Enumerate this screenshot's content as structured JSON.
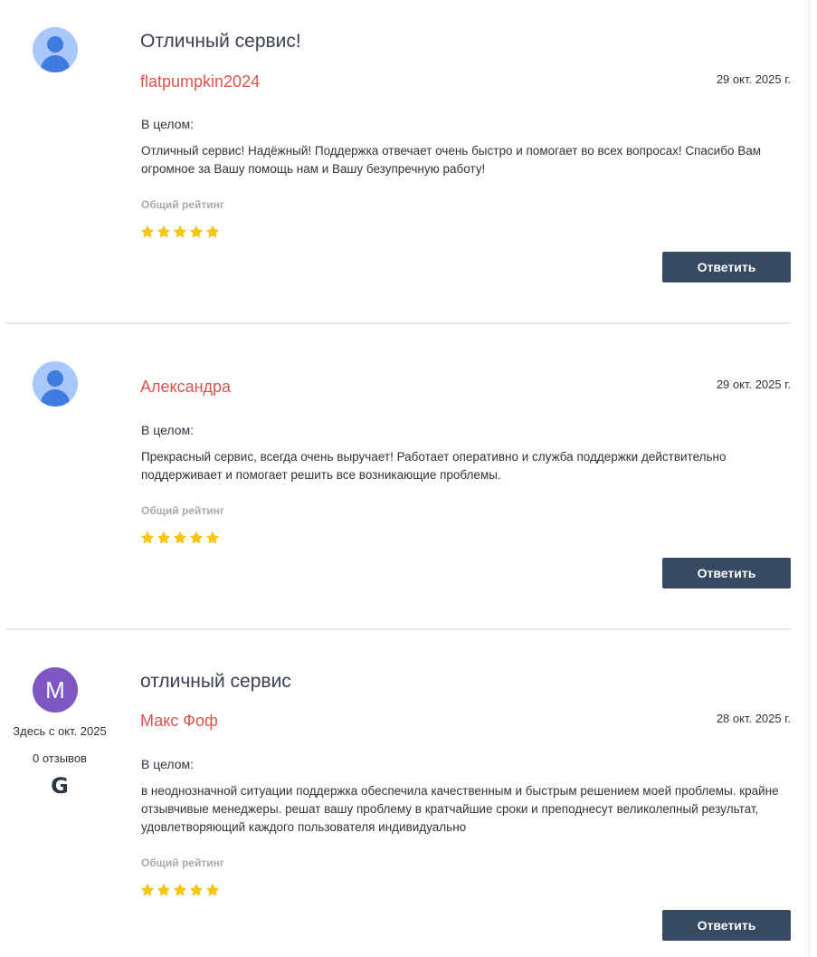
{
  "reviews": [
    {
      "title": "Отличный сервис!",
      "author": "flatpumpkin2024",
      "date": "29 окт. 2025 г.",
      "overall_label": "В целом:",
      "text": "Отличный сервис! Надёжный! Поддержка отвечает очень быстро и помогает во всех вопросах! Спасибо Вам огромное за Вашу помощь нам и Вашу безупречную работу!",
      "rating_label": "Общий рейтинг",
      "rating": 5,
      "reply_label": "Ответить"
    },
    {
      "title": "",
      "author": "Александра",
      "date": "29 окт. 2025 г.",
      "overall_label": "В целом:",
      "text": "Прекрасный сервис, всегда очень выручает! Работает оперативно и служба поддержки действительно поддерживает и помогает решить все возникающие проблемы.",
      "rating_label": "Общий рейтинг",
      "rating": 5,
      "reply_label": "Ответить"
    },
    {
      "title": "отличный сервис",
      "author": "Макс Фоф",
      "avatar_letter": "M",
      "member_since": "Здесь с окт. 2025",
      "review_count": "0 отзывов",
      "source_icon": "google-g-icon",
      "source_glyph": "G",
      "date": "28 окт. 2025 г.",
      "overall_label": "В целом:",
      "text": "в неоднозначной ситуации поддержка обеспечила качественным и быстрым решением моей проблемы. крайне отзывчивые менеджеры. решат вашу проблему в кратчайшие сроки и преподнесут великолепный результат, удовлетворяющий каждого пользователя индивидуально",
      "rating_label": "Общий рейтинг",
      "rating": 5,
      "reply_label": "Ответить"
    }
  ],
  "colors": {
    "author": "#d9534f",
    "star": "#f5c518",
    "reply_button": "#364a63",
    "avatar_default": "#a8c7fa",
    "avatar_letter_bg": "#7e57c2"
  }
}
